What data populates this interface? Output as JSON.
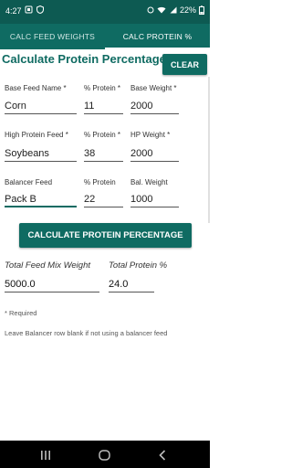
{
  "status": {
    "time": "4:27",
    "battery_text": "22%"
  },
  "tabs": [
    {
      "label": "CALC FEED WEIGHTS",
      "active": false
    },
    {
      "label": "CALC PROTEIN %",
      "active": true
    }
  ],
  "title": "Calculate Protein Percentage",
  "clear_label": "CLEAR",
  "rows": [
    {
      "name_label": "Base Feed Name *",
      "name_value": "Corn",
      "protein_label": "% Protein *",
      "protein_value": "11",
      "weight_label": "Base Weight *",
      "weight_value": "2000"
    },
    {
      "name_label": "High Protein Feed *",
      "name_value": "Soybeans",
      "protein_label": "% Protein *",
      "protein_value": "38",
      "weight_label": "HP Weight *",
      "weight_value": "2000"
    },
    {
      "name_label": "Balancer Feed",
      "name_value": "Pack B",
      "protein_label": "% Protein",
      "protein_value": "22",
      "weight_label": "Bal. Weight",
      "weight_value": "1000"
    }
  ],
  "calculate_label": "CALCULATE PROTEIN PERCENTAGE",
  "results": {
    "total_weight_label": "Total Feed Mix Weight",
    "total_weight_value": "5000.0",
    "total_protein_label": "Total Protein %",
    "total_protein_value": "24.0"
  },
  "notes": {
    "required": "* Required",
    "hint": "Leave Balancer row blank if not using a balancer feed"
  },
  "colors": {
    "primary": "#0f6b62",
    "status_bar": "#0d5a52"
  },
  "icons": [
    "notification-icon",
    "shield-icon",
    "wifi-icon",
    "signal-icon",
    "battery-icon",
    "recents-icon",
    "home-icon",
    "back-icon"
  ]
}
